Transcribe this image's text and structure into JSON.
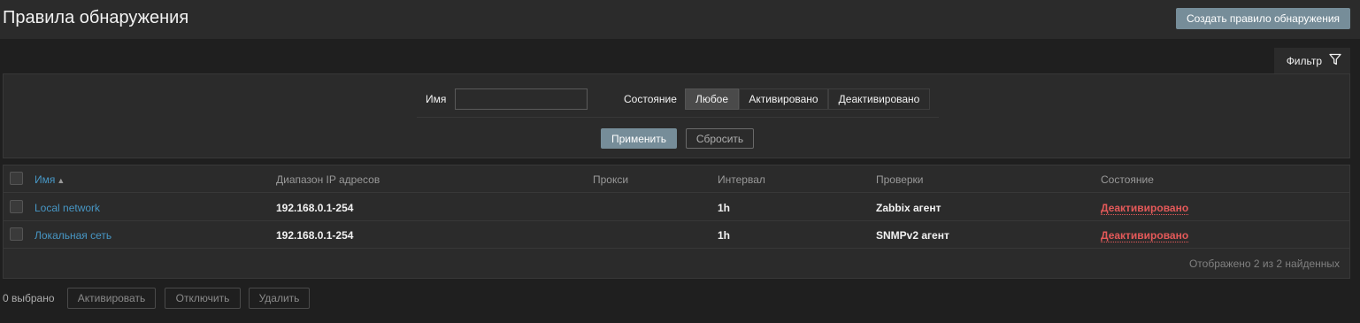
{
  "header": {
    "title": "Правила обнаружения",
    "create_button": "Создать правило обнаружения"
  },
  "filter": {
    "tab_label": "Фильтр",
    "tab_icon": "funnel-icon",
    "name_label": "Имя",
    "name_value": "",
    "status_label": "Состояние",
    "status_options": [
      "Любое",
      "Активировано",
      "Деактивировано"
    ],
    "status_selected": "Любое",
    "apply_button": "Применить",
    "reset_button": "Сбросить"
  },
  "table": {
    "columns": [
      "Имя",
      "Диапазон IP адресов",
      "Прокси",
      "Интервал",
      "Проверки",
      "Состояние"
    ],
    "sort_indicator": "▲",
    "rows": [
      {
        "name": "Local network",
        "ip_range": "192.168.0.1-254",
        "proxy": "",
        "interval": "1h",
        "checks": "Zabbix агент",
        "status": "Деактивировано"
      },
      {
        "name": "Локальная сеть",
        "ip_range": "192.168.0.1-254",
        "proxy": "",
        "interval": "1h",
        "checks": "SNMPv2 агент",
        "status": "Деактивировано"
      }
    ],
    "footer": "Отображено 2 из 2 найденных"
  },
  "bulk": {
    "selected_text": "0 выбрано",
    "buttons": [
      "Активировать",
      "Отключить",
      "Удалить"
    ]
  },
  "colors": {
    "background": "#1f1f1f",
    "panel": "#2b2b2b",
    "primary_button": "#768d99",
    "link": "#4796c4",
    "status_disabled": "#e45959"
  }
}
